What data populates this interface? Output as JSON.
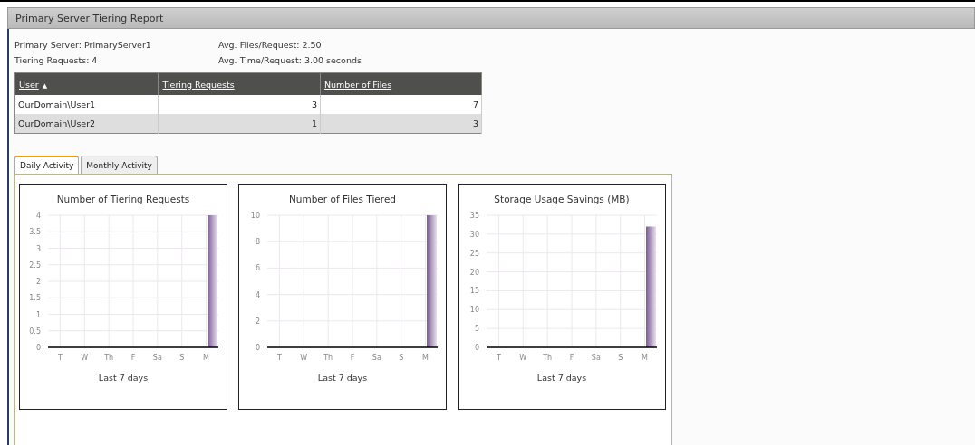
{
  "window": {
    "title": "Primary Server Tiering Report"
  },
  "summary": [
    {
      "label": "Primary Server: PrimaryServer1"
    },
    {
      "label": "Avg. Files/Request: 2.50"
    },
    {
      "label": "Tiering Requests:  4"
    },
    {
      "label": "Avg. Time/Request: 3.00 seconds"
    }
  ],
  "table": {
    "columns": [
      {
        "label": "User",
        "sort_icon": "▲"
      },
      {
        "label": "Tiering Requests"
      },
      {
        "label": "Number of Files"
      }
    ],
    "rows": [
      [
        "OurDomain\\User1",
        "3",
        "7"
      ],
      [
        "OurDomain\\User2",
        "1",
        "3"
      ]
    ]
  },
  "tabs": [
    {
      "label": "Daily Activity",
      "selected": true
    },
    {
      "label": "Monthly Activity",
      "selected": false
    }
  ],
  "charts": [
    {
      "chart_data": {
        "type": "bar",
        "grid": true,
        "title": "Number of Tiering Requests",
        "xlabel": "Last 7 days",
        "categories": [
          "T",
          "W",
          "Th",
          "F",
          "Sa",
          "S",
          "M"
        ],
        "series": [
          {
            "color": "#7a5b93",
            "values": [
              0,
              0,
              0,
              0,
              0,
              0,
              4
            ]
          }
        ],
        "ylim": [
          0,
          4
        ],
        "yticks": [
          {
            "value": 0,
            "label": "0"
          },
          {
            "value": 0.5,
            "label": "0.5"
          },
          {
            "value": 1,
            "label": "1"
          },
          {
            "value": 1.5,
            "label": "1.5"
          },
          {
            "value": 2,
            "label": "2"
          },
          {
            "value": 2.5,
            "label": "2.5"
          },
          {
            "value": 3,
            "label": "3"
          },
          {
            "value": 3.5,
            "label": "3.5"
          },
          {
            "value": 4,
            "label": "4"
          }
        ]
      }
    },
    {
      "chart_data": {
        "type": "bar",
        "grid": true,
        "title": "Number of Files Tiered",
        "xlabel": "Last 7 days",
        "categories": [
          "T",
          "W",
          "Th",
          "F",
          "Sa",
          "S",
          "M"
        ],
        "series": [
          {
            "color": "#7a5b93",
            "values": [
              0,
              0,
              0,
              0,
              0,
              0,
              10
            ]
          }
        ],
        "ylim": [
          0,
          10
        ],
        "yticks": [
          {
            "value": 0,
            "label": "0"
          },
          {
            "value": 2,
            "label": "2"
          },
          {
            "value": 4,
            "label": "4"
          },
          {
            "value": 6,
            "label": "6"
          },
          {
            "value": 8,
            "label": "8"
          },
          {
            "value": 10,
            "label": "10"
          }
        ]
      }
    },
    {
      "chart_data": {
        "type": "bar",
        "grid": true,
        "title": "Storage Usage Savings (MB)",
        "xlabel": "Last 7 days",
        "categories": [
          "T",
          "W",
          "Th",
          "F",
          "Sa",
          "S",
          "M"
        ],
        "series": [
          {
            "color": "#7a5b93",
            "values": [
              0,
              0,
              0,
              0,
              0,
              0,
              32
            ]
          }
        ],
        "ylim": [
          0,
          35
        ],
        "yticks": [
          {
            "value": 0,
            "label": "0"
          },
          {
            "value": 5,
            "label": "5"
          },
          {
            "value": 10,
            "label": "10"
          },
          {
            "value": 15,
            "label": "15"
          },
          {
            "value": 20,
            "label": "20"
          },
          {
            "value": 25,
            "label": "25"
          },
          {
            "value": 30,
            "label": "30"
          },
          {
            "value": 35,
            "label": "35"
          }
        ]
      }
    }
  ]
}
